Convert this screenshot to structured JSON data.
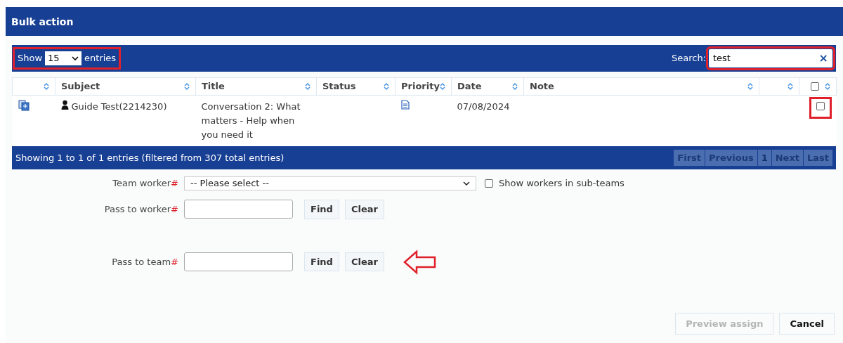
{
  "window": {
    "title": "Bulk action"
  },
  "length_menu": {
    "prefix": "Show",
    "value": "15",
    "suffix": "entries",
    "highlighted": true
  },
  "search": {
    "label": "Search:",
    "value": "test",
    "clear": "×",
    "highlighted": true
  },
  "table": {
    "columns": [
      {
        "kind": "icon"
      },
      {
        "kind": "text",
        "label": "Subject"
      },
      {
        "kind": "text",
        "label": "Title"
      },
      {
        "kind": "text",
        "label": "Status"
      },
      {
        "kind": "text",
        "label": "Priority"
      },
      {
        "kind": "text",
        "label": "Date"
      },
      {
        "kind": "text",
        "label": "Note"
      },
      {
        "kind": "blank"
      },
      {
        "kind": "checkbox",
        "checked": false
      }
    ],
    "rows": [
      {
        "subject": "Guide Test(2214230)",
        "title": "Conversation 2: What matters - Help when you need it",
        "status": "",
        "priority_icon": true,
        "date": "07/08/2024",
        "note": "",
        "checked": false,
        "highlighted": true
      }
    ]
  },
  "footer": {
    "info": "Showing 1 to 1 of 1 entries (filtered from 307 total entries)",
    "pages": [
      {
        "label": "First",
        "selected": false
      },
      {
        "label": "Previous",
        "selected": false
      },
      {
        "label": "1",
        "selected": true
      },
      {
        "label": "Next",
        "selected": false
      },
      {
        "label": "Last",
        "selected": false
      }
    ]
  },
  "form": [
    {
      "kind": "select",
      "label": "Team worker",
      "required_mark": "#",
      "value": "-- Please select --",
      "option_label": "Show workers in sub-teams",
      "option_checked": false
    },
    {
      "kind": "lookup",
      "label": "Pass to worker",
      "required_mark": "#",
      "buttons": [
        "Find",
        "Clear"
      ],
      "arrow": false
    },
    {
      "kind": "lookup",
      "label": "Pass to team",
      "required_mark": "#",
      "buttons": [
        "Find",
        "Clear"
      ],
      "arrow": true
    }
  ],
  "actions": [
    {
      "label": "Preview assign",
      "disabled": true
    },
    {
      "label": "Cancel",
      "disabled": false
    }
  ]
}
